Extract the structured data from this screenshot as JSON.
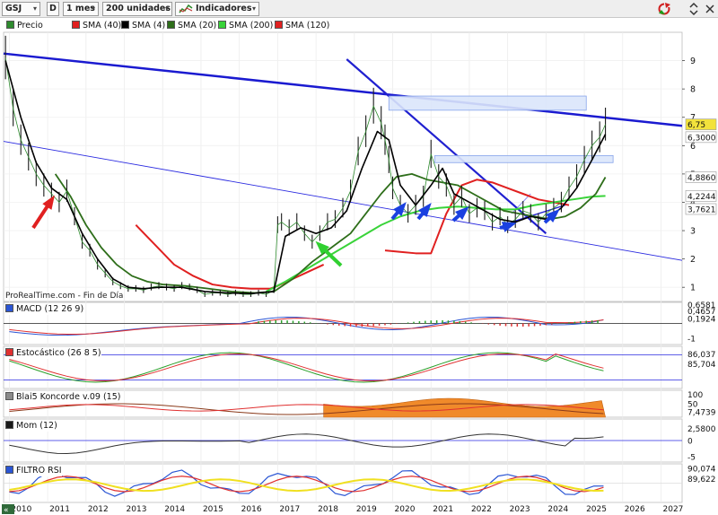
{
  "toolbar": {
    "symbol": "GSJ",
    "type_letter": "D",
    "period": "1 mes",
    "units": "200 unidades",
    "indicators": "Indicadores"
  },
  "legend": [
    {
      "label": "Precio",
      "color": "#2e8b2e"
    },
    {
      "label": "SMA (40)",
      "color": "#e02020"
    },
    {
      "label": "SMA (4)",
      "color": "#000000"
    },
    {
      "label": "SMA (20)",
      "color": "#2e6e1a"
    },
    {
      "label": "SMA (200)",
      "color": "#39d339"
    },
    {
      "label": "SMA (120)",
      "color": "#e02020"
    }
  ],
  "credit": "ProRealTime.com - Fin de Día",
  "panels": {
    "macd": "MACD (12 26 9)",
    "stoch": "Estocástico (26 8 5)",
    "blai5": "Blai5 Koncorde v.09 (15)",
    "mom": "Mom (12)",
    "rsi": "FILTRO RSI"
  },
  "price_axis": {
    "ticks": [
      "9",
      "8",
      "7",
      "6",
      "5",
      "4",
      "3",
      "2",
      "1"
    ],
    "value_labels": [
      {
        "text": "6,75",
        "bg": "#f2e23c"
      },
      {
        "text": "6,3000",
        "bg": "#ffffff"
      },
      {
        "text": "4,8860",
        "bg": "#ffffff"
      },
      {
        "text": "4,2244",
        "bg": "#ffffff"
      },
      {
        "text": "3,7621",
        "bg": "#ffffff"
      }
    ]
  },
  "macd_axis": {
    "ticks": [
      "0,6581",
      "0,4657",
      "0,1924",
      "-1"
    ]
  },
  "stoch_axis": {
    "ticks": [
      "86,037",
      "85,704"
    ]
  },
  "blai5_axis": {
    "ticks": [
      "100",
      "50",
      "7,4739"
    ]
  },
  "mom_axis": {
    "ticks": [
      "2,5800",
      "0",
      "-5"
    ]
  },
  "rsi_axis": {
    "ticks": [
      "90,074",
      "89,622"
    ]
  },
  "chart_data": {
    "type": "line",
    "x_axis_years": [
      "2010",
      "2011",
      "2012",
      "2013",
      "2014",
      "2015",
      "2016",
      "2017",
      "2018",
      "2019",
      "2020",
      "2021",
      "2022",
      "2023",
      "2024",
      "2025",
      "2026",
      "2027"
    ],
    "price": {
      "x": [
        2009.9,
        2010.1,
        2010.3,
        2010.5,
        2010.7,
        2010.9,
        2011.1,
        2011.3,
        2011.5,
        2011.7,
        2011.9,
        2012.1,
        2012.3,
        2012.5,
        2012.7,
        2012.9,
        2013.1,
        2013.3,
        2013.5,
        2013.7,
        2013.9,
        2014.1,
        2014.3,
        2014.5,
        2014.7,
        2014.9,
        2015.1,
        2015.3,
        2015.5,
        2015.7,
        2015.9,
        2016.1,
        2016.3,
        2016.5,
        2016.7,
        2016.9,
        2017.0,
        2017.1,
        2017.3,
        2017.5,
        2017.7,
        2017.9,
        2018.1,
        2018.3,
        2018.5,
        2018.7,
        2018.9,
        2019.1,
        2019.3,
        2019.5,
        2019.7,
        2019.8,
        2019.9,
        2020.0,
        2020.2,
        2020.4,
        2020.6,
        2020.8,
        2021.0,
        2021.2,
        2021.4,
        2021.6,
        2021.8,
        2022.0,
        2022.2,
        2022.4,
        2022.6,
        2022.8,
        2023.0,
        2023.2,
        2023.4,
        2023.6,
        2023.8,
        2024.0,
        2024.2,
        2024.4,
        2024.6,
        2024.8,
        2025.0,
        2025.2,
        2025.4,
        2025.55
      ],
      "values": [
        9.1,
        7.3,
        6.2,
        5.6,
        5.0,
        4.6,
        4.3,
        4.0,
        4.4,
        3.5,
        2.6,
        2.3,
        1.8,
        1.5,
        1.2,
        1.05,
        0.95,
        0.95,
        0.9,
        1.0,
        1.05,
        1.0,
        0.95,
        1.05,
        1.0,
        0.9,
        0.75,
        0.8,
        0.8,
        0.75,
        0.8,
        0.75,
        0.75,
        0.8,
        0.75,
        0.9,
        3.2,
        3.3,
        3.1,
        3.3,
        2.9,
        2.6,
        2.9,
        3.3,
        3.4,
        3.8,
        4.4,
        5.8,
        6.5,
        7.4,
        6.8,
        6.2,
        5.5,
        4.5,
        3.9,
        3.6,
        3.9,
        4.2,
        5.7,
        4.9,
        4.6,
        3.9,
        4.2,
        3.6,
        3.8,
        3.7,
        3.3,
        3.5,
        3.2,
        3.4,
        3.7,
        3.6,
        3.3,
        3.6,
        3.8,
        4.0,
        4.5,
        4.9,
        5.5,
        6.0,
        6.3,
        6.75
      ]
    },
    "sma4": {
      "x": [
        2009.9,
        2010.3,
        2010.7,
        2011.1,
        2011.5,
        2011.9,
        2012.3,
        2012.7,
        2013.1,
        2013.5,
        2013.9,
        2014.5,
        2015.1,
        2015.7,
        2016.3,
        2016.9,
        2017.2,
        2017.6,
        2018.0,
        2018.4,
        2018.8,
        2019.2,
        2019.6,
        2019.9,
        2020.2,
        2020.6,
        2021.0,
        2021.3,
        2021.6,
        2022.0,
        2022.4,
        2022.8,
        2023.2,
        2023.6,
        2024.0,
        2024.4,
        2024.8,
        2025.2,
        2025.55
      ],
      "values": [
        9.0,
        7.0,
        5.4,
        4.5,
        4.1,
        2.9,
        2.0,
        1.3,
        1.0,
        0.95,
        1.0,
        1.0,
        0.85,
        0.8,
        0.78,
        0.85,
        2.8,
        3.1,
        2.9,
        3.1,
        3.7,
        5.2,
        6.5,
        6.2,
        4.6,
        3.9,
        4.6,
        5.2,
        4.3,
        4.0,
        3.7,
        3.4,
        3.3,
        3.5,
        3.4,
        3.8,
        4.5,
        5.5,
        6.4
      ]
    },
    "sma20": {
      "x": [
        2011.2,
        2011.6,
        2012.0,
        2012.4,
        2012.8,
        2013.2,
        2013.6,
        2014.0,
        2014.6,
        2015.2,
        2015.8,
        2016.4,
        2016.9,
        2017.4,
        2017.9,
        2018.4,
        2018.9,
        2019.3,
        2019.7,
        2020.1,
        2020.5,
        2020.9,
        2021.3,
        2021.7,
        2022.1,
        2022.5,
        2022.9,
        2023.3,
        2023.7,
        2024.1,
        2024.5,
        2024.9,
        2025.3,
        2025.55
      ],
      "values": [
        5.0,
        4.2,
        3.2,
        2.4,
        1.8,
        1.4,
        1.2,
        1.1,
        1.05,
        0.95,
        0.85,
        0.8,
        0.85,
        1.3,
        1.9,
        2.4,
        2.9,
        3.6,
        4.3,
        4.9,
        5.0,
        4.8,
        4.7,
        4.6,
        4.3,
        4.0,
        3.7,
        3.6,
        3.5,
        3.4,
        3.5,
        3.8,
        4.3,
        4.886
      ]
    },
    "sma40": {
      "x": [
        2013.3,
        2013.8,
        2014.3,
        2014.8,
        2015.3,
        2015.8,
        2016.3,
        2016.8,
        2017.0,
        2017.4,
        2017.8,
        2018.2
      ],
      "values": [
        3.2,
        2.5,
        1.8,
        1.4,
        1.1,
        1.0,
        0.95,
        0.95,
        1.05,
        1.3,
        1.55,
        1.8
      ]
    },
    "sma120": {
      "x": [
        2019.8,
        2020.2,
        2020.6,
        2021.0,
        2021.4,
        2021.8,
        2022.2,
        2022.6,
        2023.0,
        2023.4,
        2023.8,
        2024.2,
        2024.6
      ],
      "values": [
        2.3,
        2.25,
        2.2,
        2.2,
        3.6,
        4.6,
        4.8,
        4.7,
        4.5,
        4.3,
        4.1,
        4.0,
        3.9
      ]
    },
    "sma200": {
      "x": [
        2016.7,
        2017.2,
        2017.7,
        2018.2,
        2018.7,
        2019.2,
        2019.7,
        2020.2,
        2020.7,
        2021.2,
        2021.7,
        2022.2,
        2022.7,
        2023.2,
        2023.7,
        2024.2,
        2024.7,
        2025.2,
        2025.55
      ],
      "values": [
        0.85,
        1.2,
        1.6,
        2.0,
        2.4,
        2.8,
        3.2,
        3.5,
        3.7,
        3.8,
        3.85,
        3.8,
        3.75,
        3.75,
        3.9,
        4.0,
        4.1,
        4.2,
        4.2244
      ]
    },
    "ylim": [
      0.5,
      10.0
    ]
  }
}
